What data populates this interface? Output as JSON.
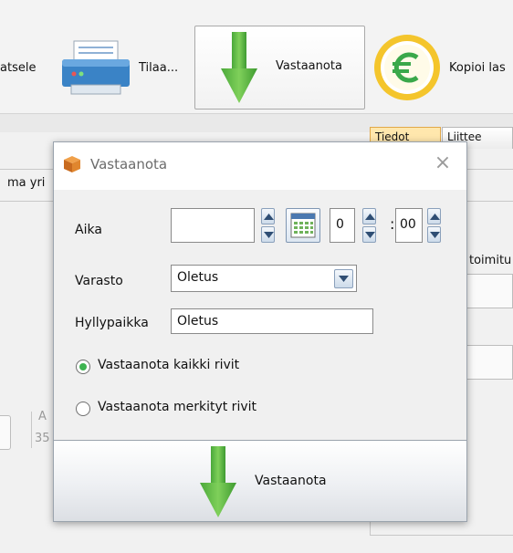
{
  "toolbar": {
    "buttons": [
      {
        "label": "atsele",
        "icon": "preview-icon"
      },
      {
        "label": "Tilaa...",
        "icon": "printer-icon"
      },
      {
        "label": "Vastaanota",
        "icon": "green-down-arrow-icon"
      },
      {
        "label": "Kopioi las",
        "icon": "euro-coin-icon"
      }
    ]
  },
  "background": {
    "tabs": [
      "Tiedot",
      "Liittee"
    ],
    "left_text": "ma yri",
    "right_text": "toimitu",
    "side_text_1": "A",
    "side_text_2": "35"
  },
  "dialog": {
    "title": "Vastaanota",
    "close_glyph": "×",
    "time": {
      "label": "Aika",
      "date_value": "",
      "hour_value": "0",
      "minute_value": "00",
      "separator": ":"
    },
    "warehouse": {
      "label": "Varasto",
      "value": "Oletus"
    },
    "shelf": {
      "label": "Hyllypaikka",
      "value": "Oletus"
    },
    "radio_options": [
      {
        "label": "Vastaanota kaikki rivit",
        "checked": true
      },
      {
        "label": "Vastaanota merkityt rivit",
        "checked": false
      }
    ],
    "confirm_button": {
      "label": "Vastaanota"
    }
  },
  "colors": {
    "accent_green": "#3eb451",
    "tab_active": "#ffe7ad",
    "dialog_border": "#9aa3ad"
  }
}
